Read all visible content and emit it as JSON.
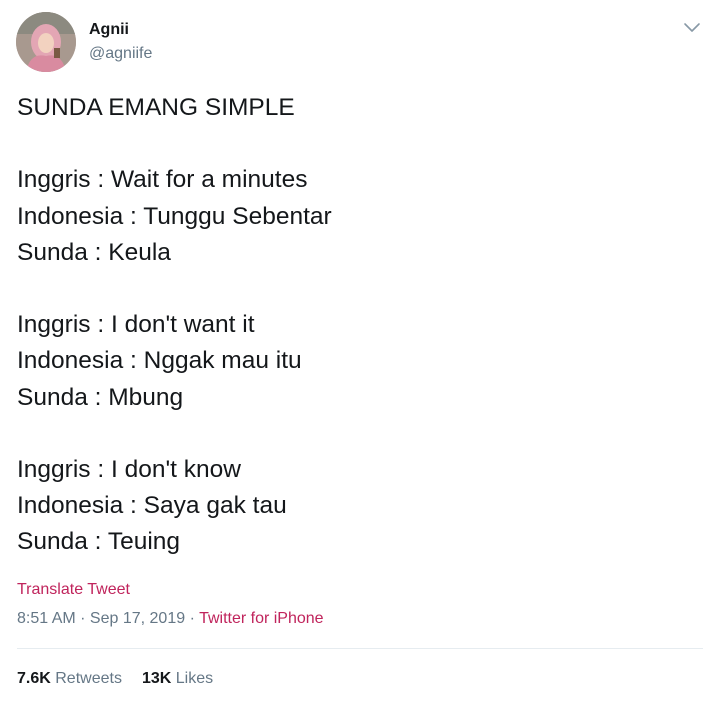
{
  "author": {
    "name": "Agnii",
    "handle": "@agniife"
  },
  "tweet": {
    "lines": [
      "SUNDA EMANG SIMPLE",
      "",
      "Inggris : Wait for a minutes",
      "Indonesia : Tunggu Sebentar",
      "Sunda : Keula",
      "",
      "Inggris : I don't want it",
      "Indonesia : Nggak mau itu",
      "Sunda : Mbung",
      "",
      "Inggris : I don't know",
      "Indonesia : Saya gak tau",
      "Sunda : Teuing"
    ]
  },
  "translate_label": "Translate Tweet",
  "meta": {
    "time": "8:51 AM",
    "separator": " · ",
    "date": "Sep 17, 2019",
    "source": "Twitter for iPhone"
  },
  "stats": {
    "retweets_count": "7.6K",
    "retweets_label": "Retweets",
    "likes_count": "13K",
    "likes_label": "Likes"
  },
  "colors": {
    "accent": "#c0245c",
    "secondary_text": "#657786",
    "primary_text": "#14171a"
  },
  "icons": {
    "menu": "chevron-down-icon"
  }
}
